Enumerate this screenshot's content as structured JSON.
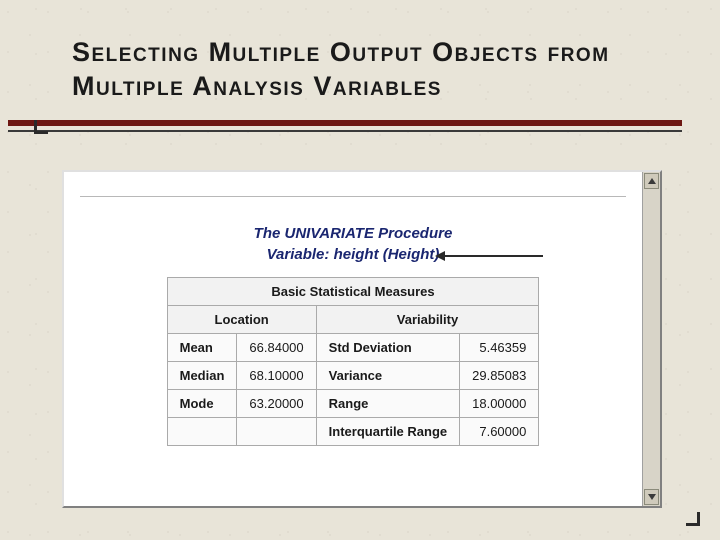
{
  "slide": {
    "title": "Selecting Multiple Output Objects from Multiple Analysis Variables"
  },
  "output": {
    "proc_title": "The UNIVARIATE Procedure",
    "variable_line": "Variable: height (Height)",
    "table_title": "Basic Statistical Measures",
    "col_location": "Location",
    "col_variability": "Variability",
    "rows": {
      "mean_lbl": "Mean",
      "mean_val": "66.84000",
      "median_lbl": "Median",
      "median_val": "68.10000",
      "mode_lbl": "Mode",
      "mode_val": "63.20000",
      "std_lbl": "Std Deviation",
      "std_val": "5.46359",
      "var_lbl": "Variance",
      "var_val": "29.85083",
      "range_lbl": "Range",
      "range_val": "18.00000",
      "iqr_lbl": "Interquartile Range",
      "iqr_val": "7.60000"
    }
  }
}
